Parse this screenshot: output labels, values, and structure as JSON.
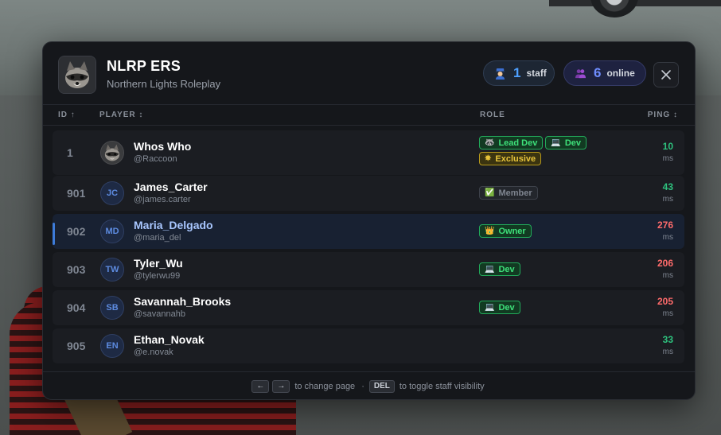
{
  "header": {
    "title": "NLRP ERS",
    "subtitle": "Northern Lights Roleplay",
    "staff_count": "1",
    "staff_label": "staff",
    "online_count": "6",
    "online_label": "online",
    "close_icon": "close-icon"
  },
  "columns": {
    "id": "ID ↑",
    "player": "PLAYER ↕",
    "role": "ROLE",
    "ping": "PING ↕"
  },
  "rows": [
    {
      "id": "1",
      "name": "Whos Who",
      "handle": "@Raccoon",
      "avatar": "raccoon-image",
      "roles": [
        {
          "label": "Lead Dev",
          "icon": "raccoon-icon"
        },
        {
          "label": "Dev",
          "icon": "laptop-icon"
        },
        {
          "label": "Exclusive",
          "icon": "sparkle-icon"
        }
      ],
      "ping": "10",
      "ping_unit": "ms",
      "ping_color": "#2ec27e"
    },
    {
      "id": "901",
      "name": "James_Carter",
      "handle": "@james.carter",
      "avatar": "JC",
      "roles": [
        {
          "label": "Member",
          "icon": "check-icon"
        }
      ],
      "ping": "43",
      "ping_unit": "ms",
      "ping_color": "#2ec27e"
    },
    {
      "id": "902",
      "name": "Maria_Delgado",
      "handle": "@maria_del",
      "avatar": "MD",
      "selected": true,
      "roles": [
        {
          "label": "Owner",
          "icon": "crown-icon"
        }
      ],
      "ping": "276",
      "ping_unit": "ms",
      "ping_color": "#ff6b6b"
    },
    {
      "id": "903",
      "name": "Tyler_Wu",
      "handle": "@tylerwu99",
      "avatar": "TW",
      "roles": [
        {
          "label": "Dev",
          "icon": "laptop-icon"
        }
      ],
      "ping": "206",
      "ping_unit": "ms",
      "ping_color": "#ff6b6b"
    },
    {
      "id": "904",
      "name": "Savannah_Brooks",
      "handle": "@savannahb",
      "avatar": "SB",
      "roles": [
        {
          "label": "Dev",
          "icon": "laptop-icon"
        }
      ],
      "ping": "205",
      "ping_unit": "ms",
      "ping_color": "#ff6b6b"
    },
    {
      "id": "905",
      "name": "Ethan_Novak",
      "handle": "@e.novak",
      "avatar": "EN",
      "roles": [],
      "ping": "33",
      "ping_unit": "ms",
      "ping_color": "#2ec27e"
    }
  ],
  "footer": {
    "key_left": "←",
    "key_right": "→",
    "text_page": "to change page",
    "separator": "·",
    "key_del": "DEL",
    "text_toggle": "to toggle staff visibility"
  },
  "colors": {
    "accent": "#3d7bd9",
    "ping_good": "#2ec27e",
    "ping_bad": "#ff6b6b",
    "badge_green": "#3ee07a",
    "badge_gold": "#e6c33a"
  }
}
